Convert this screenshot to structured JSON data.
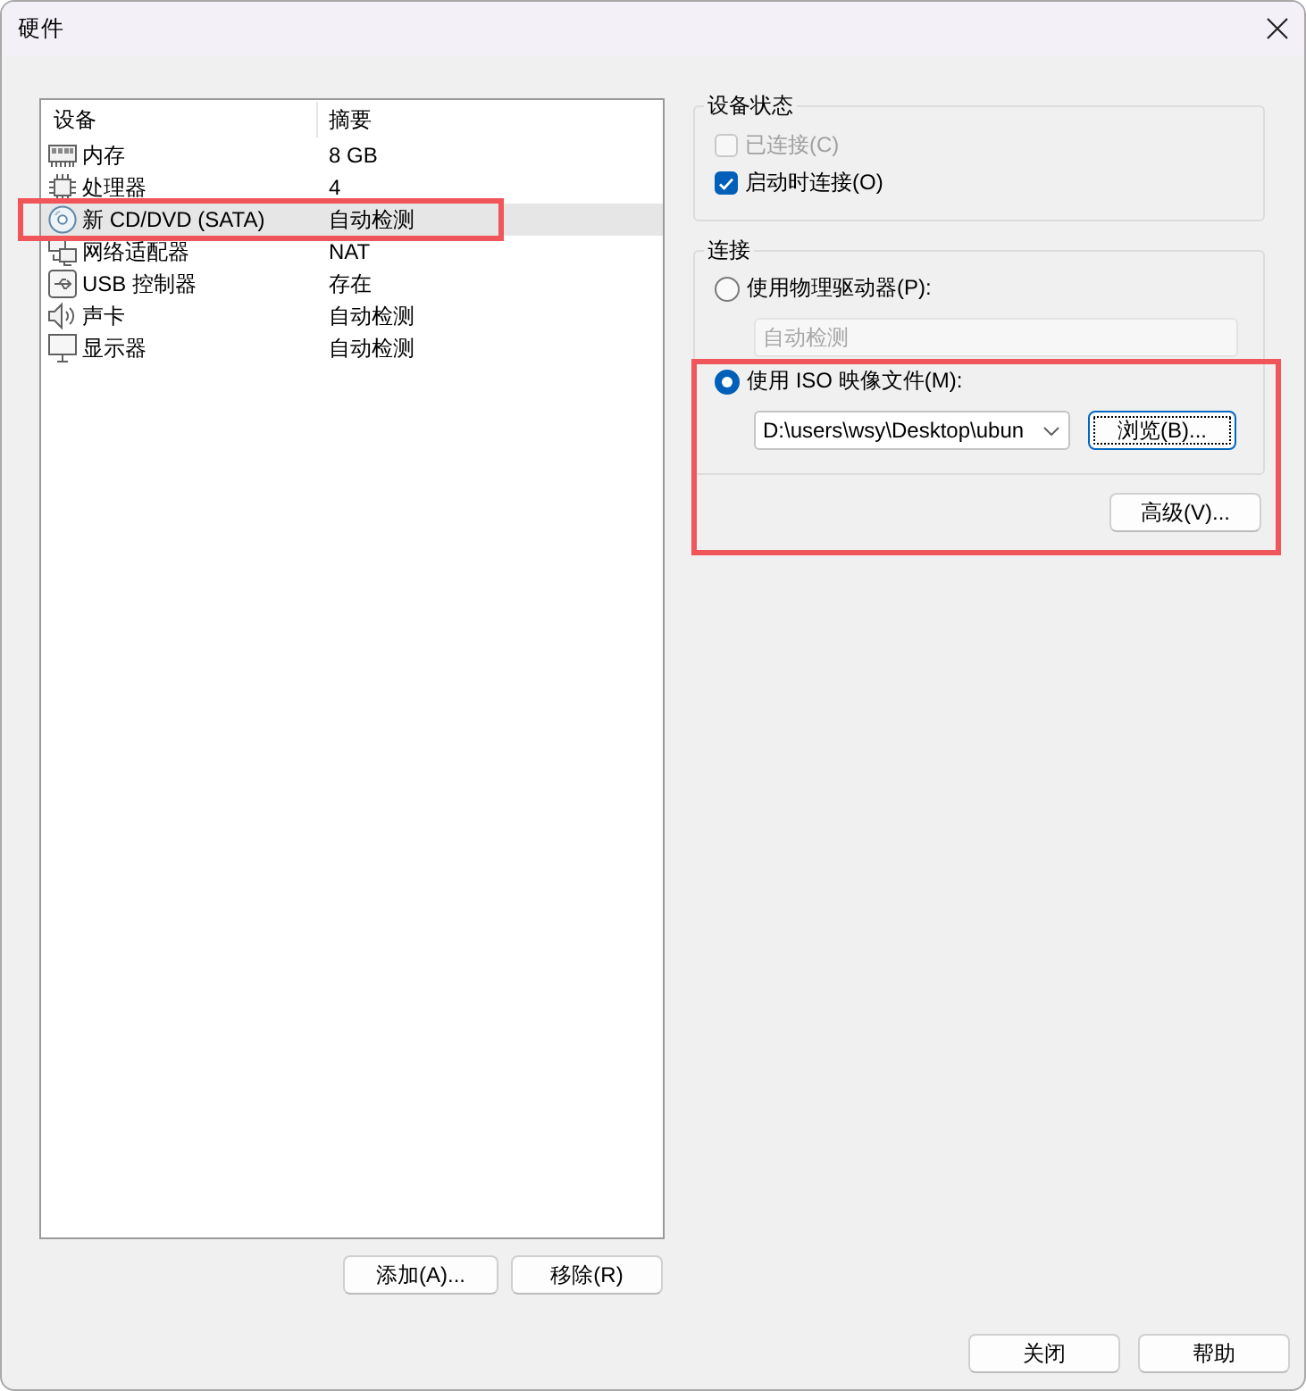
{
  "window": {
    "title": "硬件"
  },
  "device_list": {
    "columns": [
      "设备",
      "摘要"
    ],
    "rows": [
      {
        "kind": "memory",
        "device": "内存",
        "summary": "8 GB",
        "selected": false,
        "highlighted": false
      },
      {
        "kind": "processor",
        "device": "处理器",
        "summary": "4",
        "selected": false,
        "highlighted": false
      },
      {
        "kind": "disc",
        "device": "新 CD/DVD (SATA)",
        "summary": "自动检测",
        "selected": true,
        "highlighted": true
      },
      {
        "kind": "network",
        "device": "网络适配器",
        "summary": "NAT",
        "selected": false,
        "highlighted": false
      },
      {
        "kind": "usb",
        "device": "USB 控制器",
        "summary": "存在",
        "selected": false,
        "highlighted": false
      },
      {
        "kind": "sound",
        "device": "声卡",
        "summary": "自动检测",
        "selected": false,
        "highlighted": false
      },
      {
        "kind": "display",
        "device": "显示器",
        "summary": "自动检测",
        "selected": false,
        "highlighted": false
      }
    ]
  },
  "list_buttons": [
    "添加(A)...",
    "移除(R)"
  ],
  "device_status": {
    "title": "设备状态",
    "options": [
      {
        "label": "已连接(C)",
        "checked": false,
        "disabled": true
      },
      {
        "label": "启动时连接(O)",
        "checked": true,
        "disabled": false
      }
    ]
  },
  "connection": {
    "title": "连接",
    "options": [
      {
        "label": "使用物理驱动器(P):",
        "selected": false,
        "highlighted": false,
        "field": {
          "value": "自动检测",
          "disabled": true
        }
      },
      {
        "label": "使用 ISO 映像文件(M):",
        "selected": true,
        "highlighted": true,
        "field": {
          "value": "D:\\users\\wsy\\Desktop\\ubun",
          "disabled": false
        },
        "button": {
          "label": "浏览(B)...",
          "focused": true
        }
      }
    ]
  },
  "advanced_button": "高级(V)...",
  "footer_buttons": [
    "关闭",
    "帮助"
  ]
}
